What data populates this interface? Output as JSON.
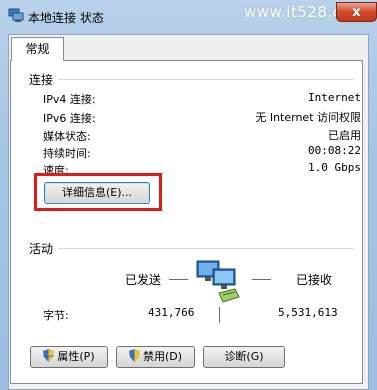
{
  "window": {
    "title": "本地连接 状态",
    "watermark": "www.it528.com",
    "close_label": "x"
  },
  "tabs": [
    {
      "label": "常规"
    }
  ],
  "connection": {
    "title": "连接",
    "rows": [
      {
        "label": "IPv4 连接:",
        "value": "Internet"
      },
      {
        "label": "IPv6 连接:",
        "value": "无 Internet 访问权限"
      },
      {
        "label": "媒体状态:",
        "value": "已启用"
      },
      {
        "label": "持续时间:",
        "value": "00:08:22"
      },
      {
        "label": "速度:",
        "value": "1.0 Gbps"
      }
    ],
    "details_button": "详细信息(E)..."
  },
  "activity": {
    "title": "活动",
    "sent_label": "已发送",
    "received_label": "已接收",
    "bytes_label": "字节:",
    "bytes_sent": "431,766",
    "bytes_received": "5,531,613"
  },
  "buttons": {
    "properties": "属性(P)",
    "disable": "禁用(D)",
    "diagnose": "诊断(G)"
  },
  "colors": {
    "highlight": "#e21a1a",
    "title_bar": "#a6c4e4"
  }
}
